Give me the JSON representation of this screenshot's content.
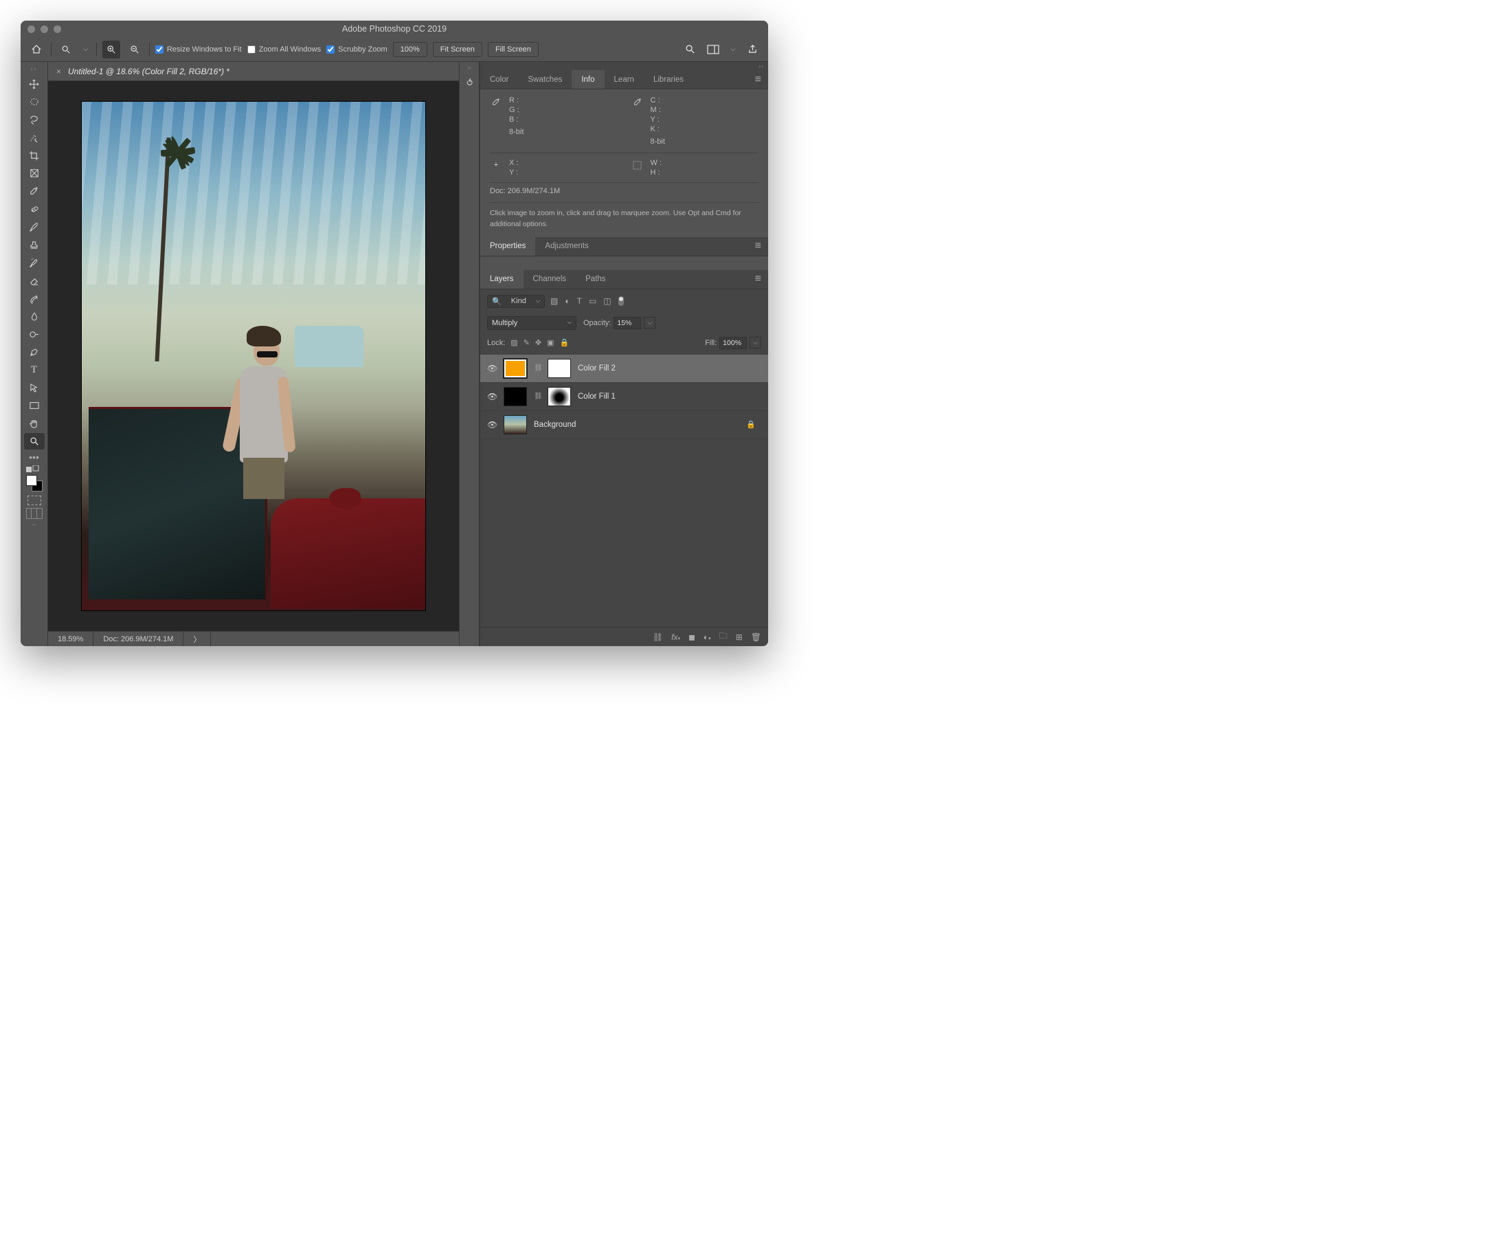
{
  "title": "Adobe Photoshop CC 2019",
  "options": {
    "resize_windows": "Resize Windows to Fit",
    "zoom_all": "Zoom All Windows",
    "scrubby": "Scrubby Zoom",
    "zoom_pct": "100%",
    "fit": "Fit Screen",
    "fill": "Fill Screen"
  },
  "doc_tab": "Untitled-1 @ 18.6% (Color Fill 2, RGB/16*) *",
  "status": {
    "zoom": "18.59%",
    "doc": "Doc: 206.9M/274.1M"
  },
  "info_panel": {
    "tabs": [
      "Color",
      "Swatches",
      "Info",
      "Learn",
      "Libraries"
    ],
    "rgb": [
      "R :",
      "G :",
      "B :"
    ],
    "cmyk": [
      "C :",
      "M :",
      "Y :",
      "K :"
    ],
    "bit1": "8-bit",
    "bit2": "8-bit",
    "xy": [
      "X :",
      "Y :"
    ],
    "wh": [
      "W :",
      "H :"
    ],
    "doc": "Doc: 206.9M/274.1M",
    "hint": "Click image to zoom in, click and drag to marquee zoom.  Use Opt and Cmd for additional options."
  },
  "mid_panel": {
    "tabs": [
      "Properties",
      "Adjustments"
    ]
  },
  "layers_panel": {
    "tabs": [
      "Layers",
      "Channels",
      "Paths"
    ],
    "kind": "Kind",
    "blend": "Multiply",
    "opacity_label": "Opacity:",
    "opacity": "15%",
    "lock_label": "Lock:",
    "fill_label": "Fill:",
    "fill": "100%",
    "layers": [
      {
        "name": "Color Fill 2"
      },
      {
        "name": "Color Fill 1"
      },
      {
        "name": "Background"
      }
    ]
  }
}
